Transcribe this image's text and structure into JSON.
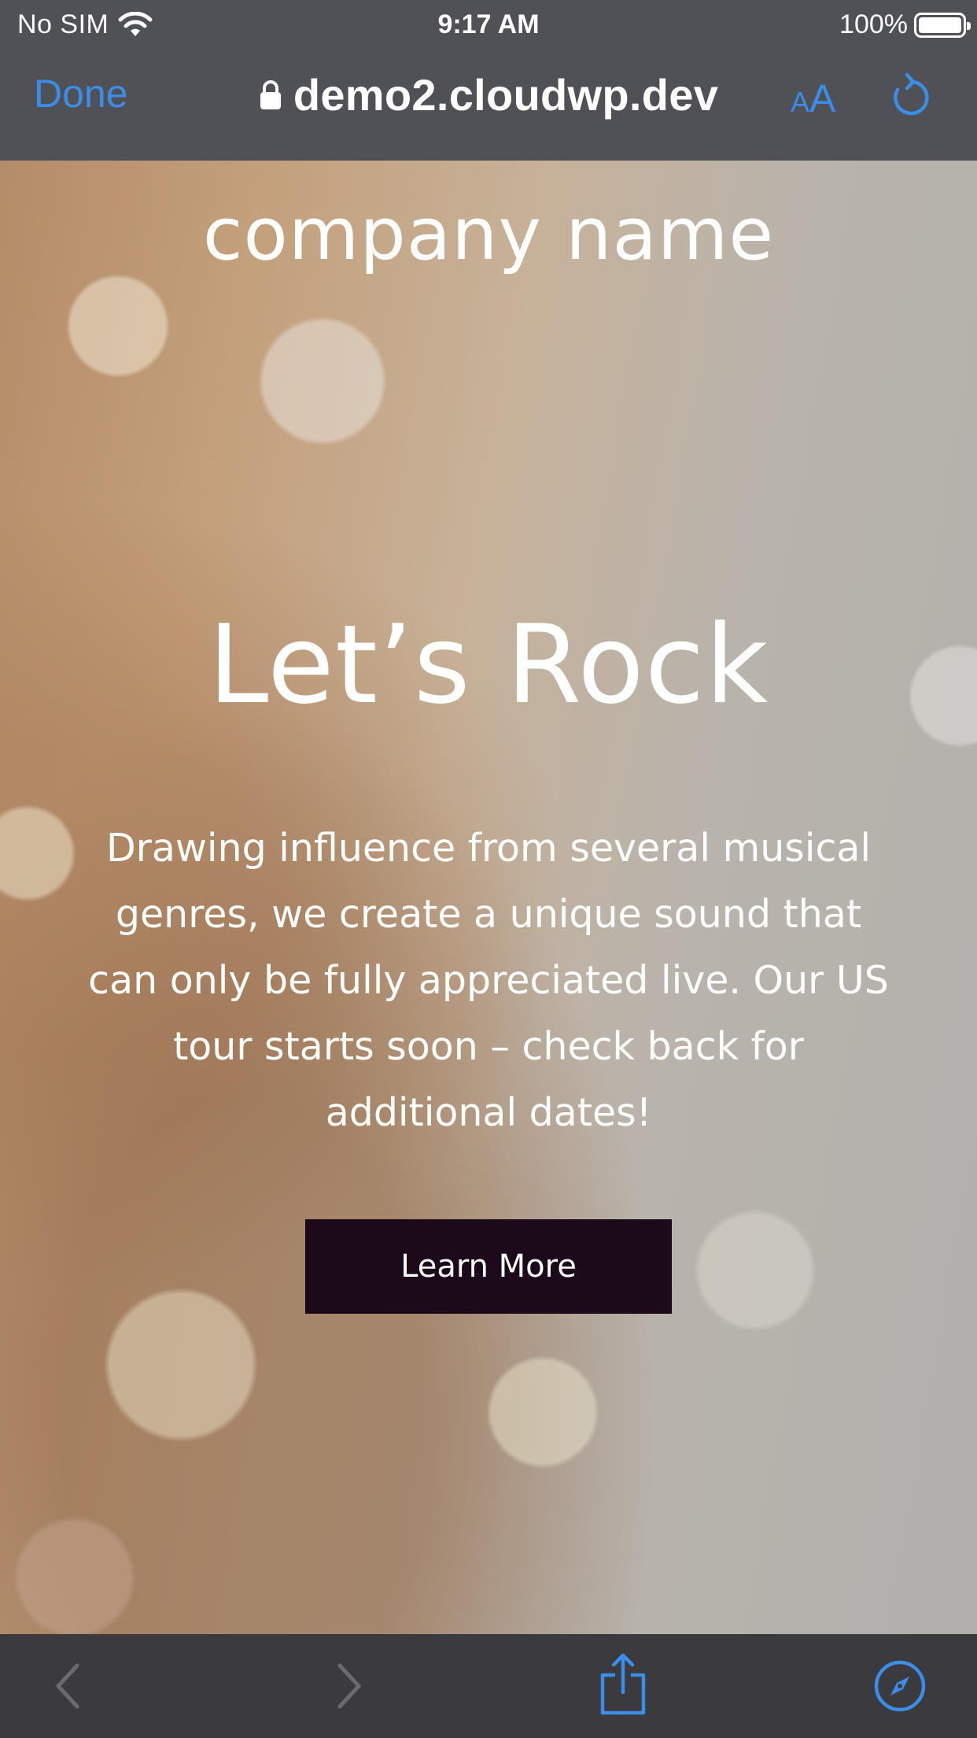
{
  "status_bar": {
    "carrier": "No SIM",
    "time": "9:17 AM",
    "battery": "100%",
    "battery_level": 1.0
  },
  "browser": {
    "done_label": "Done",
    "url": "demo2.cloudwp.dev",
    "text_size_small": "A",
    "text_size_large": "A",
    "accent_color": "#3b8de8"
  },
  "page": {
    "company_name": "company name",
    "hero_title": "Let’s Rock",
    "hero_body": "Drawing influence from several musical genres, we create a unique sound that can only be fully appreciated live. Our US tour starts soon – check back for additional dates!",
    "cta_label": "Learn More",
    "cta_color": "#1c0a1b"
  },
  "toolbar": {
    "icons": [
      "back-icon",
      "forward-icon",
      "share-icon",
      "compass-icon"
    ],
    "back_enabled": false,
    "forward_enabled": false
  }
}
